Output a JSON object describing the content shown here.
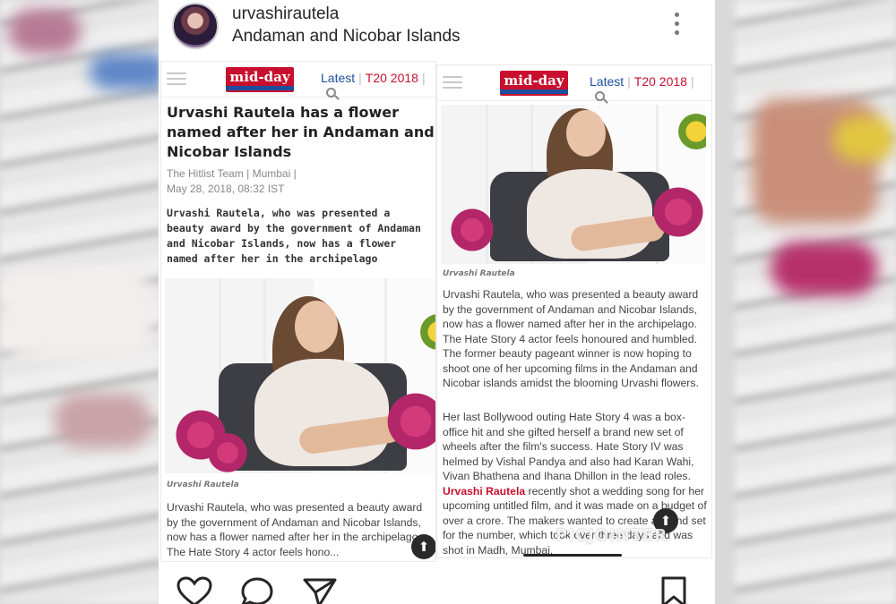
{
  "post": {
    "username": "urvashirautela",
    "location": "Andaman and Nicobar Islands"
  },
  "site": {
    "logo": "mid-day",
    "nav_latest": "Latest",
    "nav_sep": "|",
    "nav_t20": "T20 2018"
  },
  "left": {
    "headline": "Urvashi Rautela has a flower named after her in Andaman and Nicobar Islands",
    "byline": "The Hitlist Team  |  Mumbai  |",
    "date": "May 28, 2018, 08:32 IST",
    "summary": "Urvashi Rautela, who was presented a beauty award by the government of Andaman and Nicobar Islands, now has a flower named after her in the archipelago",
    "caption": "Urvashi Rautela",
    "body": "Urvashi Rautela, who was presented a beauty award by the government of Andaman and Nicobar Islands, now has a flower named after her in the archipelago. The Hate Story 4 actor feels hono..."
  },
  "right": {
    "caption": "Urvashi Rautela",
    "para1": "Urvashi Rautela, who was presented a beauty award by the government of Andaman and Nicobar Islands, now has a flower named after her in the archipelago. The Hate Story 4 actor feels honoured and humbled. The former beauty pageant winner is now hoping to shoot one of her upcoming films in the Andaman and Nicobar islands amidst the blooming Urvashi flowers.",
    "para2_a": "Her last Bollywood outing Hate Story 4 was a box-office hit and she gifted herself a brand new set of wheels after the film's success. Hate Story IV was helmed by Vishal Pandya and also had Karan Wahi, Vivan Bhathena and Ihana Dhillon in the lead roles.",
    "para2_link": "Urvashi Rautela",
    "para2_b": " recently shot a wedding song for her upcoming untitled film, and it was made on a budget of over a crore. The makers wanted to create a grand set for the number, which took over three days and was shot in Madh, Mumbai."
  },
  "watermark": "PICJOINTER",
  "up_arrow": "⬆",
  "icons": {
    "more": "more-vertical-icon",
    "heart": "heart-icon",
    "comment": "comment-icon",
    "share": "share-icon",
    "bookmark": "bookmark-icon"
  },
  "colors": {
    "brand_red": "#c8102e",
    "brand_blue": "#1d4e9e",
    "text": "#262626"
  }
}
